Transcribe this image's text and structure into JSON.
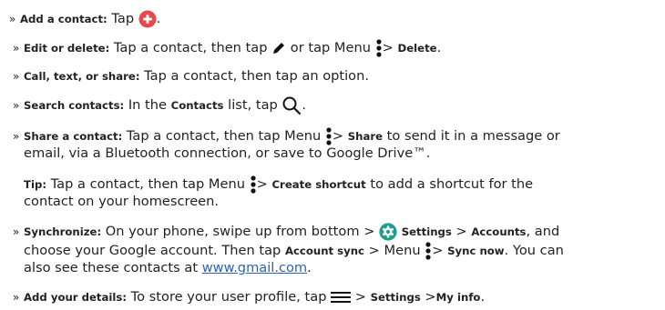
{
  "add": {
    "label": "Add a contact:",
    "text": " Tap ",
    "end": "."
  },
  "edit": {
    "label": "Edit or delete:",
    "text1": " Tap a contact, then tap ",
    "text2": " or tap Menu ",
    "sep": "> ",
    "action": "Delete",
    "end": "."
  },
  "call": {
    "label": "Call, text, or share:",
    "text": " Tap a contact, then tap an option."
  },
  "search": {
    "label": "Search contacts:",
    "text1": " In the ",
    "list": "Contacts",
    "text2": " list, tap"
  },
  "share": {
    "label": "Share a contact:",
    "text1": " Tap a contact, then tap Menu ",
    "sep": "> ",
    "action": "Share",
    "text2": " to send it in a message or",
    "line2": "email, via a Bluetooth connection, or save to Google Drive™."
  },
  "tip": {
    "label": "Tip:",
    "text1": " Tap a contact, then tap Menu ",
    "sep": "> ",
    "action": "Create shortcut",
    "text2": " to add a shortcut for the",
    "line2": "contact on your homescreen."
  },
  "sync": {
    "label": "Synchronize:",
    "text1": " On your phone, swipe up from bottom > ",
    "settings": "Settings",
    "sep1": " > ",
    "accounts": "Accounts",
    "text2": ", and",
    "line2a": "choose your Google account. Then tap ",
    "account_sync": "Account sync",
    "line2b": " > Menu ",
    "sep2": "> ",
    "sync_now": "Sync now",
    "line2c": ". You can",
    "line3a": "also see these contacts at ",
    "link": "www.gmail.com",
    "line3b": "."
  },
  "details": {
    "label": "Add your details:",
    "text1": " To store your user profile, tap ",
    "sep1": " > ",
    "settings": "Settings",
    "sep2": " >",
    "myinfo": "My info",
    "end": "."
  },
  "chevron": "»",
  "colors": {
    "add_icon": "#e5484d",
    "settings_icon": "#1f9e8c",
    "link": "#2a62b8"
  }
}
